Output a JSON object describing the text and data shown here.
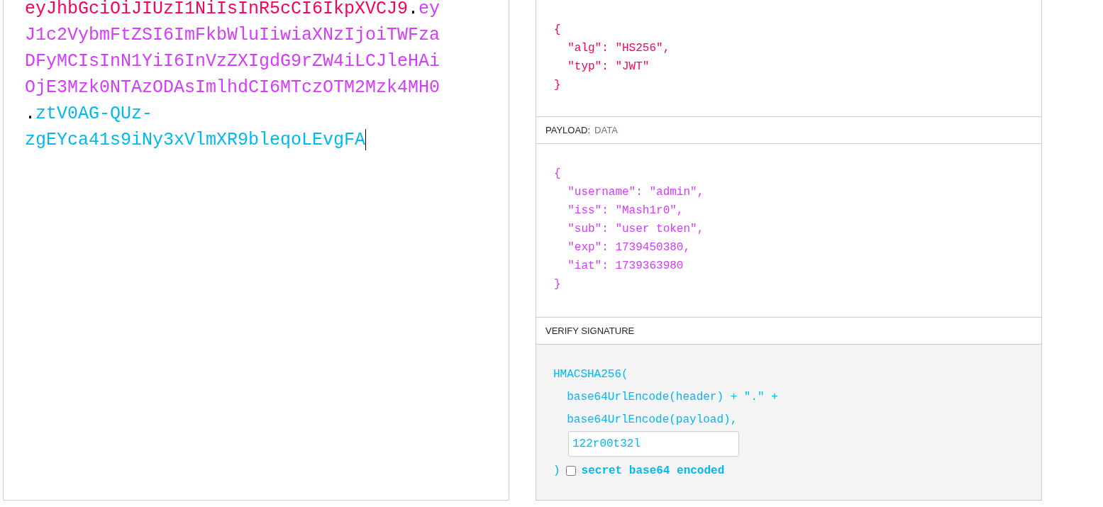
{
  "encoded": {
    "lines": [
      [
        {
          "kind": "header",
          "text": "eyJhbGciOiJIUzI1NiIsInR5cCI6IkpXVCJ9"
        },
        {
          "kind": "dot",
          "text": "."
        },
        {
          "kind": "payload",
          "text": "ey"
        }
      ],
      [
        {
          "kind": "payload",
          "text": "J1c2VybmFtZSI6ImFkbWluIiwiaXNzIjoiTWFza"
        }
      ],
      [
        {
          "kind": "payload",
          "text": "DFyMCIsInN1YiI6InVzZXIgdG9rZW4iLCJleHAi"
        }
      ],
      [
        {
          "kind": "payload",
          "text": "OjE3Mzk0NTAzODAsImlhdCI6MTczOTM2Mzk4MH0"
        }
      ],
      [
        {
          "kind": "dot",
          "text": "."
        },
        {
          "kind": "signature",
          "text": "ztV0AG-QUz-"
        }
      ],
      [
        {
          "kind": "signature",
          "text": "zgEYca41s9iNy3xVlmXR9bleqoLEvgFA"
        }
      ]
    ],
    "caret": true
  },
  "header": {
    "lines": [
      "{",
      "  \"alg\": \"HS256\",",
      "  \"typ\": \"JWT\"",
      "}"
    ]
  },
  "payload": {
    "title": "PAYLOAD:",
    "subtitle": "DATA",
    "lines": [
      "{",
      "  \"username\": \"admin\",",
      "  \"iss\": \"Mash1r0\",",
      "  \"sub\": \"user token\",",
      "  \"exp\": 1739450380,",
      "  \"iat\": 1739363980",
      "}"
    ]
  },
  "verify": {
    "title": "VERIFY SIGNATURE",
    "lines": [
      "HMACSHA256(",
      "  base64UrlEncode(header) + \".\" +",
      "  base64UrlEncode(payload),"
    ],
    "secret": "122r00t32l",
    "close": ")",
    "base64_checkbox": {
      "label": "secret base64 encoded",
      "checked": false
    }
  }
}
